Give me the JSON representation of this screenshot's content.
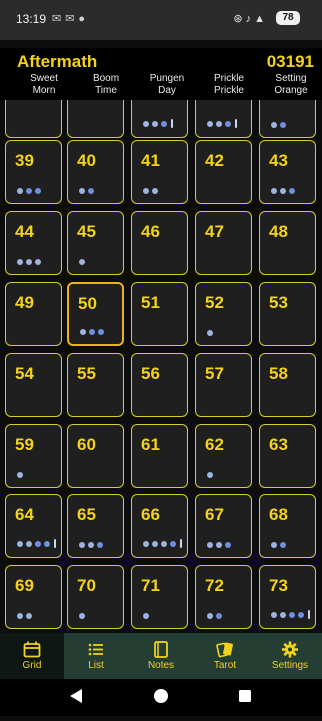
{
  "status_bar": {
    "time": "13:19",
    "battery": "78"
  },
  "header": {
    "title": "Aftermath",
    "code": "03191",
    "columns": [
      {
        "line1": "Sweet",
        "line2": "Morn"
      },
      {
        "line1": "Boom",
        "line2": "Time"
      },
      {
        "line1": "Pungen",
        "line2": "Day"
      },
      {
        "line1": "Prickle",
        "line2": "Prickle"
      },
      {
        "line1": "Setting",
        "line2": "Orange"
      }
    ]
  },
  "grid": {
    "selected": 50,
    "cells": [
      {
        "number": "",
        "light": 0,
        "deep": 0,
        "bar": false
      },
      {
        "number": "",
        "light": 0,
        "deep": 0,
        "bar": false
      },
      {
        "number": "",
        "light": 2,
        "deep": 1,
        "bar": true
      },
      {
        "number": "",
        "light": 2,
        "deep": 1,
        "bar": true
      },
      {
        "number": "",
        "light": 1,
        "deep": 1,
        "bar": false
      },
      {
        "number": "39",
        "light": 1,
        "deep": 2,
        "bar": false
      },
      {
        "number": "40",
        "light": 1,
        "deep": 1,
        "bar": false
      },
      {
        "number": "41",
        "light": 2,
        "deep": 0,
        "bar": false
      },
      {
        "number": "42",
        "light": 0,
        "deep": 0,
        "bar": false
      },
      {
        "number": "43",
        "light": 2,
        "deep": 1,
        "bar": false
      },
      {
        "number": "44",
        "light": 3,
        "deep": 0,
        "bar": false
      },
      {
        "number": "45",
        "light": 1,
        "deep": 0,
        "bar": false
      },
      {
        "number": "46",
        "light": 0,
        "deep": 0,
        "bar": false
      },
      {
        "number": "47",
        "light": 0,
        "deep": 0,
        "bar": false
      },
      {
        "number": "48",
        "light": 0,
        "deep": 0,
        "bar": false
      },
      {
        "number": "49",
        "light": 0,
        "deep": 0,
        "bar": false
      },
      {
        "number": "50",
        "light": 1,
        "deep": 2,
        "bar": false
      },
      {
        "number": "51",
        "light": 0,
        "deep": 0,
        "bar": false
      },
      {
        "number": "52",
        "light": 1,
        "deep": 0,
        "bar": false
      },
      {
        "number": "53",
        "light": 0,
        "deep": 0,
        "bar": false
      },
      {
        "number": "54",
        "light": 0,
        "deep": 0,
        "bar": false
      },
      {
        "number": "55",
        "light": 0,
        "deep": 0,
        "bar": false
      },
      {
        "number": "56",
        "light": 0,
        "deep": 0,
        "bar": false
      },
      {
        "number": "57",
        "light": 0,
        "deep": 0,
        "bar": false
      },
      {
        "number": "58",
        "light": 0,
        "deep": 0,
        "bar": false
      },
      {
        "number": "59",
        "light": 1,
        "deep": 0,
        "bar": false
      },
      {
        "number": "60",
        "light": 0,
        "deep": 0,
        "bar": false
      },
      {
        "number": "61",
        "light": 0,
        "deep": 0,
        "bar": false
      },
      {
        "number": "62",
        "light": 1,
        "deep": 0,
        "bar": false
      },
      {
        "number": "63",
        "light": 0,
        "deep": 0,
        "bar": false
      },
      {
        "number": "64",
        "light": 2,
        "deep": 2,
        "bar": true
      },
      {
        "number": "65",
        "light": 2,
        "deep": 1,
        "bar": false
      },
      {
        "number": "66",
        "light": 3,
        "deep": 1,
        "bar": true
      },
      {
        "number": "67",
        "light": 2,
        "deep": 1,
        "bar": false
      },
      {
        "number": "68",
        "light": 1,
        "deep": 1,
        "bar": false
      },
      {
        "number": "69",
        "light": 2,
        "deep": 0,
        "bar": false
      },
      {
        "number": "70",
        "light": 1,
        "deep": 0,
        "bar": false
      },
      {
        "number": "71",
        "light": 1,
        "deep": 0,
        "bar": false
      },
      {
        "number": "72",
        "light": 1,
        "deep": 1,
        "bar": false
      },
      {
        "number": "73",
        "light": 2,
        "deep": 2,
        "bar": true
      }
    ]
  },
  "bottom_nav": {
    "active": "grid",
    "items": [
      {
        "id": "grid",
        "label": "Grid",
        "icon": "calendar-icon"
      },
      {
        "id": "list",
        "label": "List",
        "icon": "list-icon"
      },
      {
        "id": "notes",
        "label": "Notes",
        "icon": "book-icon"
      },
      {
        "id": "tarot",
        "label": "Tarot",
        "icon": "cards-icon"
      },
      {
        "id": "settings",
        "label": "Settings",
        "icon": "gear-icon"
      }
    ]
  },
  "colors": {
    "accent": "#f2d21d",
    "cell_border": "#d8cc2a",
    "selected_border": "#e8b321",
    "nav_bg": "#243e33"
  }
}
